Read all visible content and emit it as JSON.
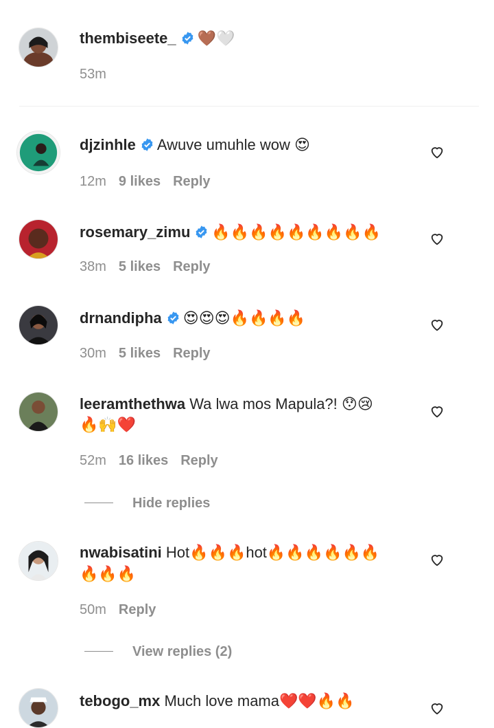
{
  "caption": {
    "username": "thembiseete_",
    "text": "🤎🤍",
    "time": "53m"
  },
  "comments": [
    {
      "username": "djzinhle",
      "text": "Awuve umuhle wow 😍",
      "time": "12m",
      "likes": "9 likes",
      "reply": "Reply"
    },
    {
      "username": "rosemary_zimu",
      "text": "🔥🔥🔥🔥🔥🔥🔥🔥🔥",
      "time": "38m",
      "likes": "5 likes",
      "reply": "Reply"
    },
    {
      "username": "drnandipha",
      "text": "😍😍😍🔥🔥🔥🔥",
      "time": "30m",
      "likes": "5 likes",
      "reply": "Reply"
    },
    {
      "username": "leeramthethwa",
      "text": "Wa lwa mos Mapula?! 😯😢",
      "text2": "🔥🙌❤️",
      "time": "52m",
      "likes": "16 likes",
      "reply": "Reply",
      "replies_toggle": "Hide replies"
    },
    {
      "username": "nwabisatini",
      "text": "Hot🔥🔥🔥hot🔥🔥🔥🔥🔥🔥",
      "text2": "🔥🔥🔥",
      "time": "50m",
      "reply": "Reply",
      "replies_toggle": "View replies (2)"
    },
    {
      "username": "tebogo_mx",
      "text": "Much love mama❤️❤️🔥🔥"
    }
  ],
  "icons": {
    "verified": "verified-badge-icon",
    "like": "heart-outline-icon"
  },
  "colors": {
    "verified": "#3897f0",
    "muted": "#8e8e8e",
    "text": "#262626"
  }
}
